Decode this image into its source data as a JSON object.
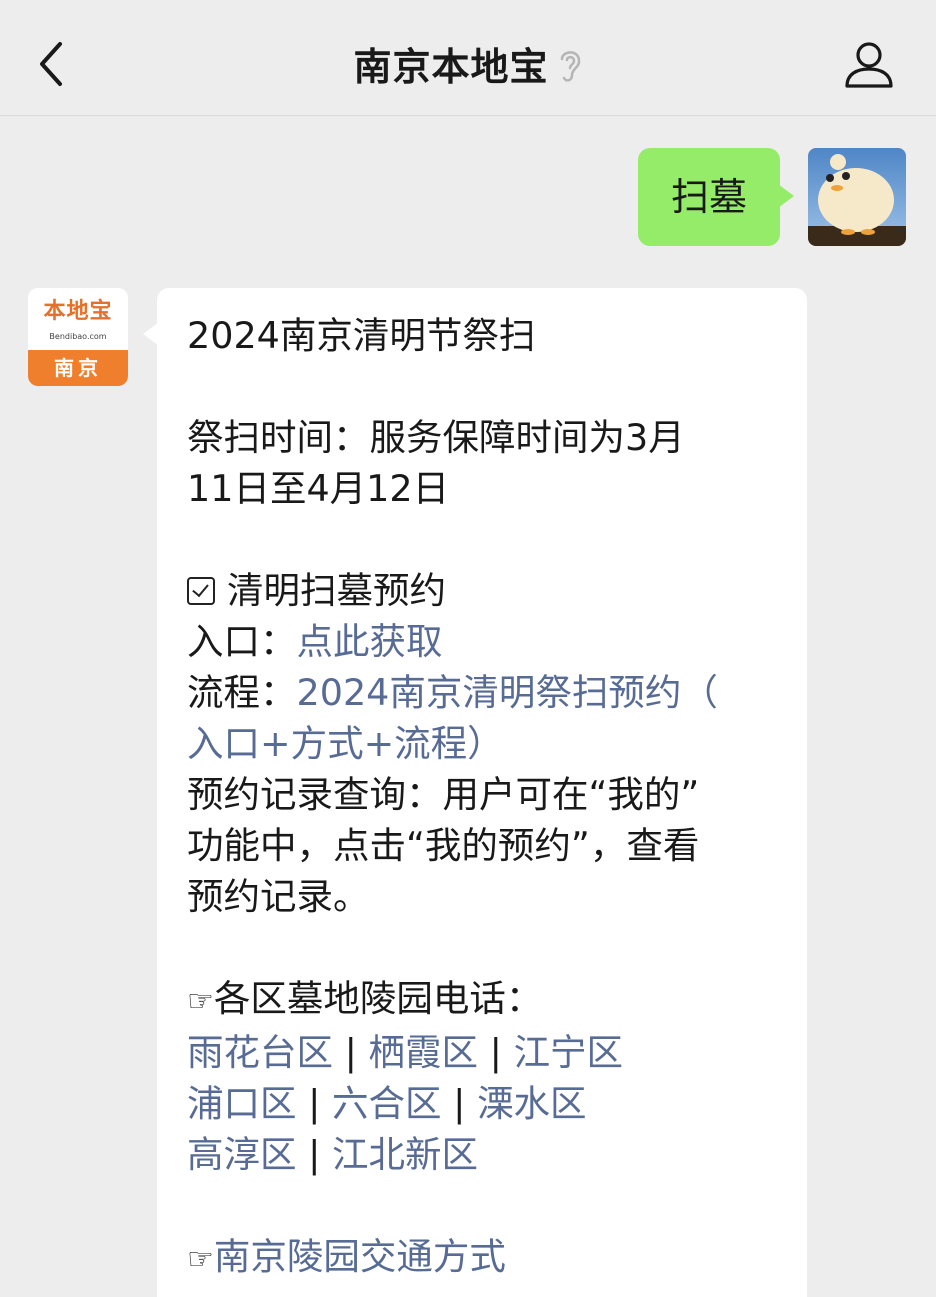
{
  "header": {
    "title": "南京本地宝"
  },
  "user_message": {
    "text": "扫墓"
  },
  "bot_avatar": {
    "logo_text": "本地宝",
    "logo_domain": "Bendibao.com",
    "city": "南京"
  },
  "reply": {
    "title": "2024南京清明节祭扫",
    "time_line1": "祭扫时间：服务保障时间为3月",
    "time_line2": "11日至4月12日",
    "booking_heading": "清明扫墓预约",
    "entry_label": "入口：",
    "entry_link": "点此获取",
    "process_label": "流程：",
    "process_link_line1": "2024南京清明祭扫预约（",
    "process_link_line2": "入口+方式+流程）",
    "record_line1": "预约记录查询：用户可在“我的”",
    "record_line2": "功能中，点击“我的预约”，查看",
    "record_line3": "预约记录。",
    "hand_glyph": "☞",
    "phones_heading": "各区墓地陵园电话：",
    "separator": "|",
    "districts": [
      "雨花台区",
      "栖霞区",
      "江宁区",
      "浦口区",
      "六合区",
      "溧水区",
      "高淳区",
      "江北新区"
    ],
    "traffic_link": "南京陵园交通方式"
  },
  "colors": {
    "background": "#ededed",
    "user_bubble": "#95ec69",
    "link": "#576b95",
    "brand_orange": "#ef7f2d"
  },
  "icons": [
    "back-icon",
    "ear-icon",
    "profile-icon",
    "checkbox-icon",
    "pointing-hand-icon"
  ]
}
